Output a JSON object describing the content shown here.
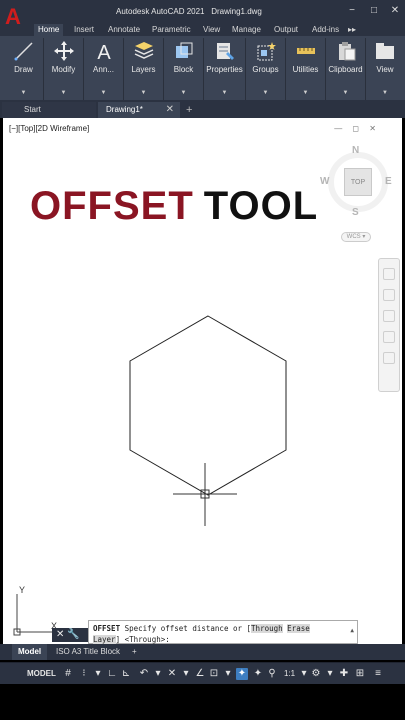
{
  "window": {
    "title": "Autodesk AutoCAD 2021",
    "document": "Drawing1.dwg",
    "logo": "A",
    "controls": {
      "minimize": "−",
      "restore": "□",
      "close": "✕"
    }
  },
  "ribbon_tabs": [
    "Home",
    "Insert",
    "Annotate",
    "Parametric",
    "View",
    "Manage",
    "Output",
    "Add-ins"
  ],
  "ribbon_more": "▸▸",
  "ribbon_panels": [
    {
      "label": "Draw",
      "icon": "line-icon"
    },
    {
      "label": "Modify",
      "icon": "move-icon"
    },
    {
      "label": "Ann...",
      "icon": "text-a-icon"
    },
    {
      "label": "Layers",
      "icon": "layers-icon"
    },
    {
      "label": "Block",
      "icon": "block-icon"
    },
    {
      "label": "Properties",
      "icon": "properties-icon"
    },
    {
      "label": "Groups",
      "icon": "groups-icon"
    },
    {
      "label": "Utilities",
      "icon": "measure-icon"
    },
    {
      "label": "Clipboard",
      "icon": "clipboard-icon"
    },
    {
      "label": "View",
      "icon": "view-icon"
    }
  ],
  "file_tabs": {
    "start": "Start",
    "drawing": "Drawing1*",
    "add": "+",
    "close": "✕"
  },
  "viewport": {
    "controls": "[−][Top][2D Wireframe]",
    "buttons": "— ◻ ✕"
  },
  "overlay_title": {
    "word1": "OFFSET",
    "word2": "TOOL"
  },
  "viewcube": {
    "north": "N",
    "south": "S",
    "east": "E",
    "west": "W",
    "face": "TOP",
    "wcs": "WCS ▾"
  },
  "command_line": {
    "command": "OFFSET",
    "prompt": " Specify offset distance or [",
    "option1": "Through",
    "option2": "Erase",
    "option3": "Layer",
    "tail": "] <Through>:"
  },
  "command_tools": "✕ 🔧",
  "ucs": {
    "x": "X",
    "y": "Y"
  },
  "layout_tabs": [
    "Model",
    "ISO A3 Title Block",
    "+"
  ],
  "status_bar": {
    "model": "MODEL",
    "scale": "1:1"
  },
  "colors": {
    "title_red": "#8a1523",
    "ui_dark": "#2b3241",
    "ribbon": "#3b4455"
  }
}
